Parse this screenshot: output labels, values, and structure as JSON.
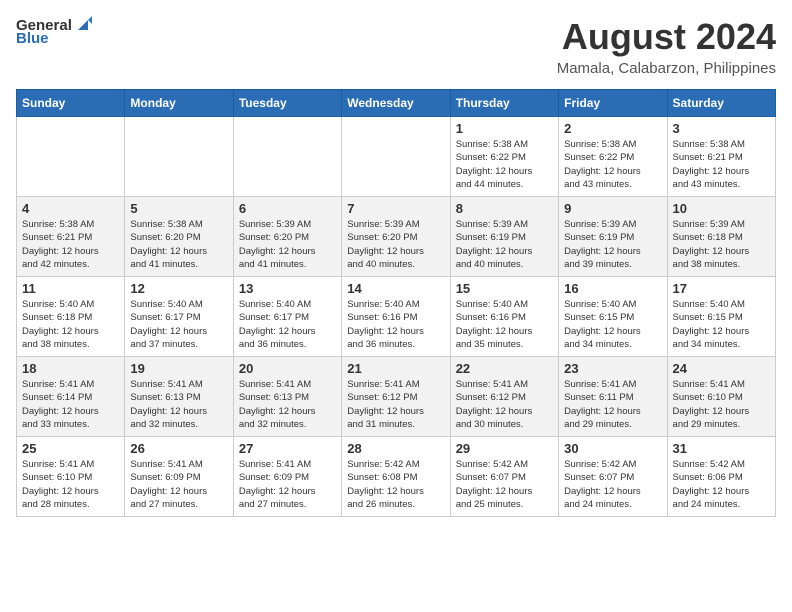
{
  "header": {
    "logo_general": "General",
    "logo_blue": "Blue",
    "month_title": "August 2024",
    "location": "Mamala, Calabarzon, Philippines"
  },
  "weekdays": [
    "Sunday",
    "Monday",
    "Tuesday",
    "Wednesday",
    "Thursday",
    "Friday",
    "Saturday"
  ],
  "weeks": [
    [
      {
        "day": "",
        "info": ""
      },
      {
        "day": "",
        "info": ""
      },
      {
        "day": "",
        "info": ""
      },
      {
        "day": "",
        "info": ""
      },
      {
        "day": "1",
        "info": "Sunrise: 5:38 AM\nSunset: 6:22 PM\nDaylight: 12 hours\nand 44 minutes."
      },
      {
        "day": "2",
        "info": "Sunrise: 5:38 AM\nSunset: 6:22 PM\nDaylight: 12 hours\nand 43 minutes."
      },
      {
        "day": "3",
        "info": "Sunrise: 5:38 AM\nSunset: 6:21 PM\nDaylight: 12 hours\nand 43 minutes."
      }
    ],
    [
      {
        "day": "4",
        "info": "Sunrise: 5:38 AM\nSunset: 6:21 PM\nDaylight: 12 hours\nand 42 minutes."
      },
      {
        "day": "5",
        "info": "Sunrise: 5:38 AM\nSunset: 6:20 PM\nDaylight: 12 hours\nand 41 minutes."
      },
      {
        "day": "6",
        "info": "Sunrise: 5:39 AM\nSunset: 6:20 PM\nDaylight: 12 hours\nand 41 minutes."
      },
      {
        "day": "7",
        "info": "Sunrise: 5:39 AM\nSunset: 6:20 PM\nDaylight: 12 hours\nand 40 minutes."
      },
      {
        "day": "8",
        "info": "Sunrise: 5:39 AM\nSunset: 6:19 PM\nDaylight: 12 hours\nand 40 minutes."
      },
      {
        "day": "9",
        "info": "Sunrise: 5:39 AM\nSunset: 6:19 PM\nDaylight: 12 hours\nand 39 minutes."
      },
      {
        "day": "10",
        "info": "Sunrise: 5:39 AM\nSunset: 6:18 PM\nDaylight: 12 hours\nand 38 minutes."
      }
    ],
    [
      {
        "day": "11",
        "info": "Sunrise: 5:40 AM\nSunset: 6:18 PM\nDaylight: 12 hours\nand 38 minutes."
      },
      {
        "day": "12",
        "info": "Sunrise: 5:40 AM\nSunset: 6:17 PM\nDaylight: 12 hours\nand 37 minutes."
      },
      {
        "day": "13",
        "info": "Sunrise: 5:40 AM\nSunset: 6:17 PM\nDaylight: 12 hours\nand 36 minutes."
      },
      {
        "day": "14",
        "info": "Sunrise: 5:40 AM\nSunset: 6:16 PM\nDaylight: 12 hours\nand 36 minutes."
      },
      {
        "day": "15",
        "info": "Sunrise: 5:40 AM\nSunset: 6:16 PM\nDaylight: 12 hours\nand 35 minutes."
      },
      {
        "day": "16",
        "info": "Sunrise: 5:40 AM\nSunset: 6:15 PM\nDaylight: 12 hours\nand 34 minutes."
      },
      {
        "day": "17",
        "info": "Sunrise: 5:40 AM\nSunset: 6:15 PM\nDaylight: 12 hours\nand 34 minutes."
      }
    ],
    [
      {
        "day": "18",
        "info": "Sunrise: 5:41 AM\nSunset: 6:14 PM\nDaylight: 12 hours\nand 33 minutes."
      },
      {
        "day": "19",
        "info": "Sunrise: 5:41 AM\nSunset: 6:13 PM\nDaylight: 12 hours\nand 32 minutes."
      },
      {
        "day": "20",
        "info": "Sunrise: 5:41 AM\nSunset: 6:13 PM\nDaylight: 12 hours\nand 32 minutes."
      },
      {
        "day": "21",
        "info": "Sunrise: 5:41 AM\nSunset: 6:12 PM\nDaylight: 12 hours\nand 31 minutes."
      },
      {
        "day": "22",
        "info": "Sunrise: 5:41 AM\nSunset: 6:12 PM\nDaylight: 12 hours\nand 30 minutes."
      },
      {
        "day": "23",
        "info": "Sunrise: 5:41 AM\nSunset: 6:11 PM\nDaylight: 12 hours\nand 29 minutes."
      },
      {
        "day": "24",
        "info": "Sunrise: 5:41 AM\nSunset: 6:10 PM\nDaylight: 12 hours\nand 29 minutes."
      }
    ],
    [
      {
        "day": "25",
        "info": "Sunrise: 5:41 AM\nSunset: 6:10 PM\nDaylight: 12 hours\nand 28 minutes."
      },
      {
        "day": "26",
        "info": "Sunrise: 5:41 AM\nSunset: 6:09 PM\nDaylight: 12 hours\nand 27 minutes."
      },
      {
        "day": "27",
        "info": "Sunrise: 5:41 AM\nSunset: 6:09 PM\nDaylight: 12 hours\nand 27 minutes."
      },
      {
        "day": "28",
        "info": "Sunrise: 5:42 AM\nSunset: 6:08 PM\nDaylight: 12 hours\nand 26 minutes."
      },
      {
        "day": "29",
        "info": "Sunrise: 5:42 AM\nSunset: 6:07 PM\nDaylight: 12 hours\nand 25 minutes."
      },
      {
        "day": "30",
        "info": "Sunrise: 5:42 AM\nSunset: 6:07 PM\nDaylight: 12 hours\nand 24 minutes."
      },
      {
        "day": "31",
        "info": "Sunrise: 5:42 AM\nSunset: 6:06 PM\nDaylight: 12 hours\nand 24 minutes."
      }
    ]
  ]
}
